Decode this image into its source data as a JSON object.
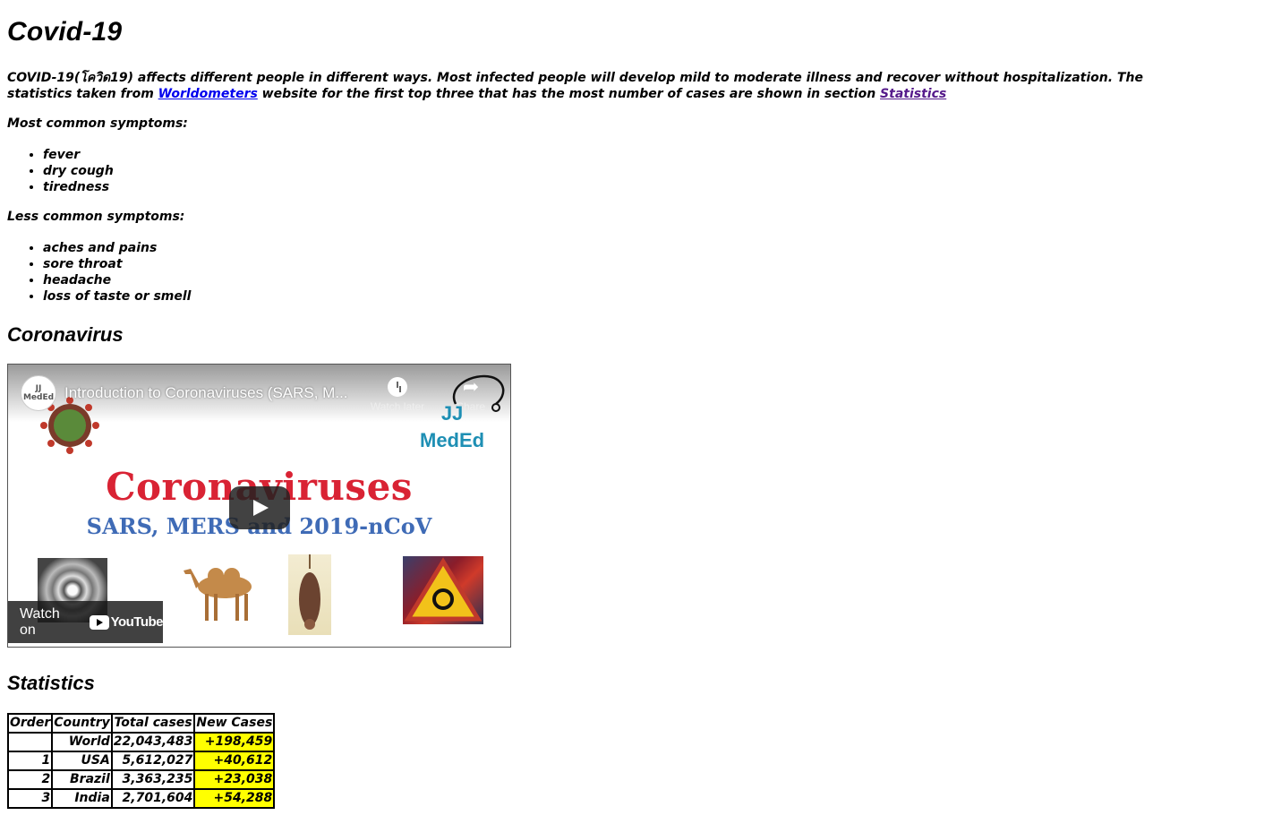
{
  "page": {
    "title": "Covid-19"
  },
  "intro": {
    "text_before": "COVID-19(โควิด19) affects different people in different ways. Most infected people will develop mild to moderate illness and recover without hospitalization. The statistics taken from ",
    "link_worldometers": "Worldometers",
    "text_middle": " website for the first top three that has the most number of cases are shown in section ",
    "link_statistics": "Statistics"
  },
  "symptoms": {
    "common_label": "Most common symptoms:",
    "common": [
      "fever",
      "dry cough",
      "tiredness"
    ],
    "less_common_label": "Less common symptoms:",
    "less_common": [
      "aches and pains",
      "sore throat",
      "headache",
      "loss of taste or smell"
    ]
  },
  "coronavirus": {
    "heading": "Coronavirus",
    "video": {
      "channel_avatar_text": "JJ MedEd",
      "title": "Introduction to Coronaviruses (SARS, M...",
      "watch_later": "Watch later",
      "share": "Share",
      "logo_line1": "JJ",
      "logo_line2": "MedEd",
      "thumb_title": "Coronaviruses",
      "thumb_subtitle": "SARS, MERS and 2019-nCoV",
      "watch_on": "Watch on",
      "youtube": "YouTube"
    }
  },
  "statistics": {
    "heading": "Statistics",
    "columns": [
      "Order",
      "Country",
      "Total cases",
      "New Cases"
    ],
    "rows": [
      {
        "order": "",
        "country": "World",
        "total": "22,043,483",
        "new": "+198,459"
      },
      {
        "order": "1",
        "country": "USA",
        "total": "5,612,027",
        "new": "+40,612"
      },
      {
        "order": "2",
        "country": "Brazil",
        "total": "3,363,235",
        "new": "+23,038"
      },
      {
        "order": "3",
        "country": "India",
        "total": "2,701,604",
        "new": "+54,288"
      }
    ],
    "highlight_color": "#ffff00"
  }
}
